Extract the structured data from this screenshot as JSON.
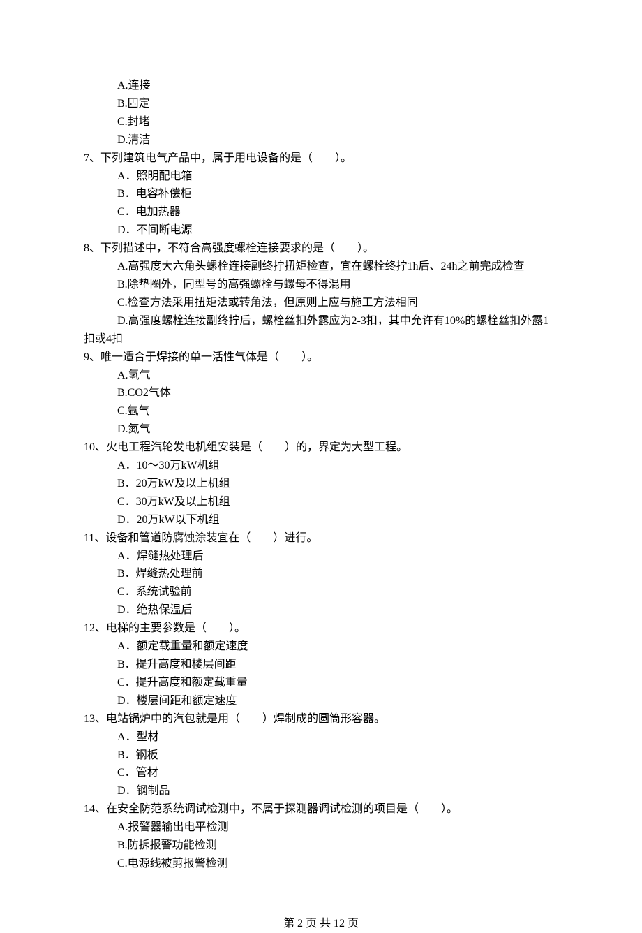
{
  "q6_options": {
    "a": "A.连接",
    "b": "B.固定",
    "c": "C.封堵",
    "d": "D.清洁"
  },
  "q7": {
    "stem": "7、下列建筑电气产品中，属于用电设备的是（　　）。",
    "a": "A．照明配电箱",
    "b": "B．电容补偿柜",
    "c": "C．电加热器",
    "d": "D．不间断电源"
  },
  "q8": {
    "stem": "8、下列描述中，不符合高强度螺栓连接要求的是（　　）。",
    "a": "A.高强度大六角头螺栓连接副终拧扭矩检查，宜在螺栓终拧1h后、24h之前完成检查",
    "b": "B.除垫圈外，同型号的高强螺栓与螺母不得混用",
    "c": "C.检查方法采用扭矩法或转角法，但原则上应与施工方法相同",
    "d1": "D.高强度螺栓连接副终拧后，螺栓丝扣外露应为2-3扣，其中允许有10%的螺栓丝扣外露1",
    "d2": "扣或4扣"
  },
  "q9": {
    "stem": "9、唯一适合于焊接的单一活性气体是（　　）。",
    "a": "A.氢气",
    "b": "B.CO2气体",
    "c": "C.氩气",
    "d": "D.氮气"
  },
  "q10": {
    "stem": "10、火电工程汽轮发电机组安装是（　　）的，界定为大型工程。",
    "a": "A．10～30万kW机组",
    "b": "B．20万kW及以上机组",
    "c": "C．30万kW及以上机组",
    "d": "D．20万kW以下机组"
  },
  "q11": {
    "stem": "11、设备和管道防腐蚀涂装宜在（　　）进行。",
    "a": "A．焊缝热处理后",
    "b": "B．焊缝热处理前",
    "c": "C．系统试验前",
    "d": "D．绝热保温后"
  },
  "q12": {
    "stem": "12、电梯的主要参数是（　　）。",
    "a": "A．额定载重量和额定速度",
    "b": "B．提升高度和楼层间距",
    "c": "C．提升高度和额定载重量",
    "d": "D．楼层间距和额定速度"
  },
  "q13": {
    "stem": "13、电站锅炉中的汽包就是用（　　）焊制成的圆筒形容器。",
    "a": "A．型材",
    "b": "B．钢板",
    "c": "C．管材",
    "d": "D．钢制品"
  },
  "q14": {
    "stem": "14、在安全防范系统调试检测中，不属于探测器调试检测的项目是（　　）。",
    "a": "A.报警器输出电平检测",
    "b": "B.防拆报警功能检测",
    "c": "C.电源线被剪报警检测"
  },
  "footer": "第 2 页 共 12 页"
}
